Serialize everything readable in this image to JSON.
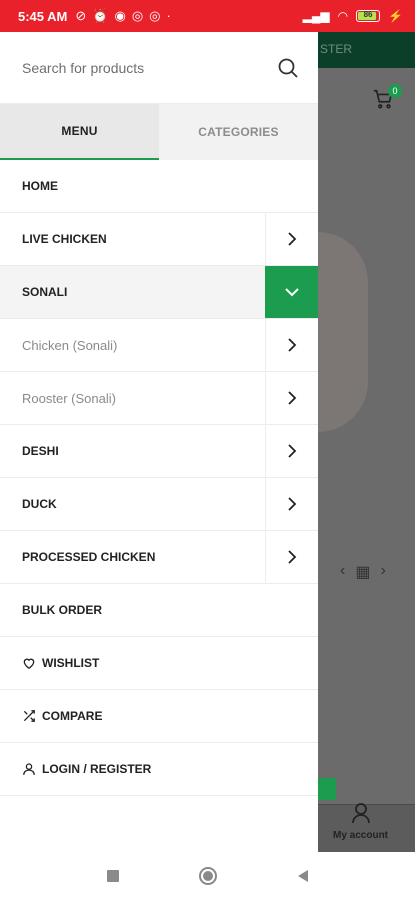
{
  "status_bar": {
    "time": "5:45 AM",
    "battery": "86",
    "icons": [
      "muted-icon",
      "alarm-icon",
      "messenger-icon",
      "whatsapp-icon",
      "whatsapp-icon",
      "dot-icon"
    ]
  },
  "background": {
    "topbar_text": "STER",
    "cart_count": "0",
    "account_label": "My account"
  },
  "drawer": {
    "search_placeholder": "Search for products",
    "tabs": [
      {
        "label": "MENU",
        "active": true
      },
      {
        "label": "CATEGORIES",
        "active": false
      }
    ],
    "items": [
      {
        "label": "HOME"
      },
      {
        "label": "LIVE CHICKEN"
      },
      {
        "label": "SONALI"
      },
      {
        "label": "Chicken (Sonali)"
      },
      {
        "label": "Rooster (Sonali)"
      },
      {
        "label": "DESHI"
      },
      {
        "label": "DUCK"
      },
      {
        "label": "PROCESSED CHICKEN"
      },
      {
        "label": "BULK ORDER"
      },
      {
        "label": "WISHLIST",
        "icon": "heart-icon"
      },
      {
        "label": "COMPARE",
        "icon": "shuffle-icon"
      },
      {
        "label": "LOGIN / REGISTER",
        "icon": "user-icon"
      }
    ]
  },
  "colors": {
    "status_bar": "#e8212a",
    "accent": "#1b9c4f",
    "overlay": "#6b6b6b"
  }
}
